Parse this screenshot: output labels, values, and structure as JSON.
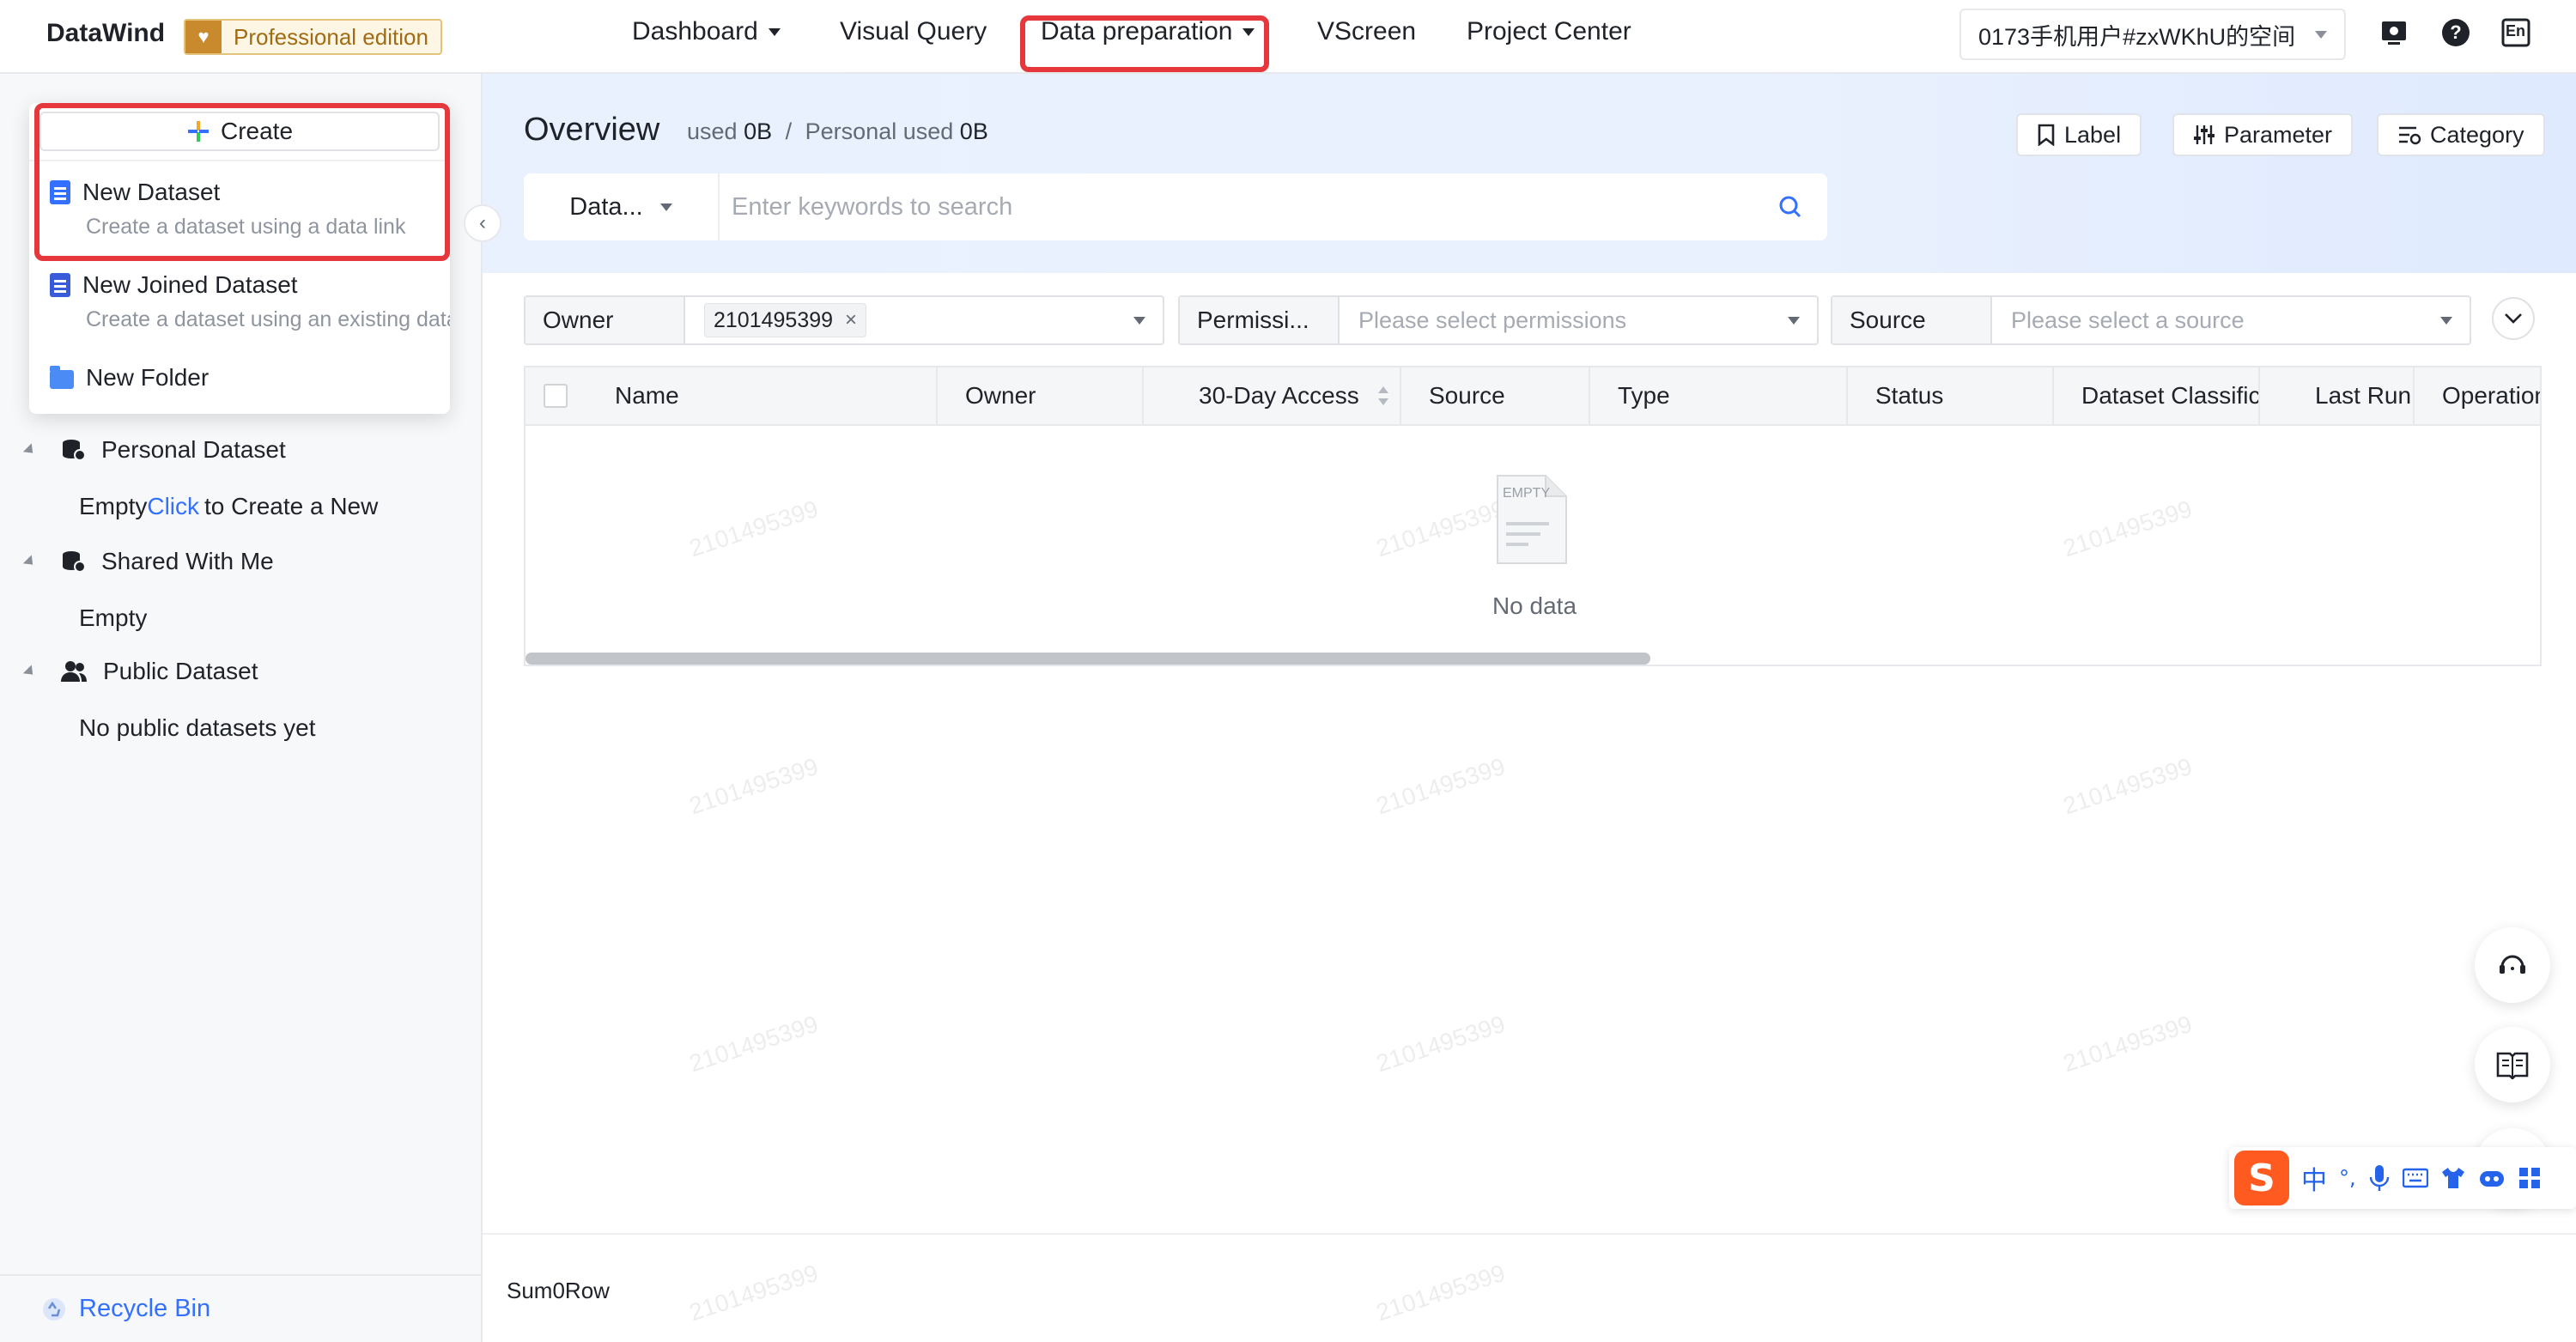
{
  "app": {
    "brand": "DataWind",
    "edition": "Professional edition"
  },
  "nav": {
    "items": [
      {
        "label": "Dashboard",
        "has_caret": true
      },
      {
        "label": "Visual Query",
        "has_caret": false
      },
      {
        "label": "Data preparation",
        "has_caret": true,
        "highlighted": true
      },
      {
        "label": "VScreen",
        "has_caret": false
      },
      {
        "label": "Project Center",
        "has_caret": false
      }
    ],
    "workspace": "0173手机用户#zxWKhU的空间",
    "icons": [
      "monitor-icon",
      "help-icon",
      "language-en-icon"
    ],
    "language_label": "En"
  },
  "create_menu": {
    "create_label": "Create",
    "items": [
      {
        "title": "New Dataset",
        "desc": "Create a dataset using a data link",
        "icon": "dataset-icon",
        "highlighted": true
      },
      {
        "title": "New Joined Dataset",
        "desc": "Create a dataset using an existing data",
        "icon": "joined-dataset-icon"
      },
      {
        "title": "New Folder",
        "desc": "",
        "icon": "folder-icon"
      }
    ]
  },
  "sidebar": {
    "sections": [
      {
        "label": "Personal Dataset",
        "icon": "personal-dataset-icon",
        "empty_prefix": "Empty",
        "empty_link": "Click",
        "empty_suffix": "to Create a New"
      },
      {
        "label": "Shared With Me",
        "icon": "shared-icon",
        "empty_text": "Empty"
      },
      {
        "label": "Public Dataset",
        "icon": "public-icon",
        "empty_text": "No public datasets yet"
      }
    ],
    "recycle_bin": "Recycle Bin"
  },
  "header": {
    "title": "Overview",
    "used_label": "used",
    "used_value": "0B",
    "separator": "/",
    "personal_label": "Personal used",
    "personal_value": "0B",
    "buttons": [
      {
        "label": "Label",
        "icon": "bookmark-icon"
      },
      {
        "label": "Parameter",
        "icon": "sliders-icon"
      },
      {
        "label": "Category",
        "icon": "category-icon"
      }
    ]
  },
  "search": {
    "type_label": "Data...",
    "placeholder": "Enter keywords to search"
  },
  "filters": {
    "owner_label": "Owner",
    "owner_tag": "2101495399",
    "permission_label": "Permissi...",
    "permission_placeholder": "Please select permissions",
    "source_label": "Source",
    "source_placeholder": "Please select a source"
  },
  "table": {
    "columns": [
      "Name",
      "Owner",
      "30-Day Access",
      "Source",
      "Type",
      "Status",
      "Dataset Classifica",
      "Last Runr",
      "Operation"
    ],
    "empty_icon_text": "EMPTY",
    "empty_text": "No data"
  },
  "footer": {
    "sum_text": "Sum0Row"
  },
  "watermark": "2101495399",
  "ime": {
    "logo": "S",
    "glyphs": [
      "中",
      "°,"
    ]
  },
  "colors": {
    "accent": "#3370ff",
    "highlight_border": "#e5373c",
    "header_bg": "#e9f1ff"
  }
}
